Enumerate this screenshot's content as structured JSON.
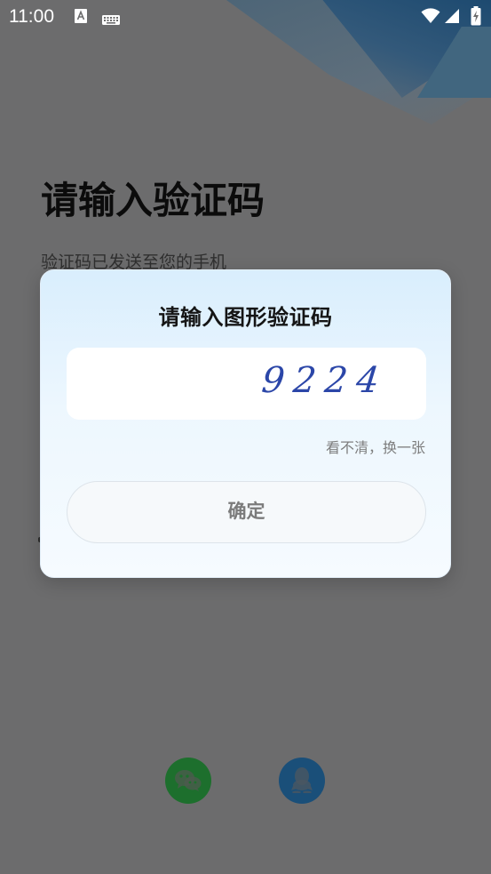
{
  "status_bar": {
    "time": "11:00",
    "icons": [
      "text-a-icon",
      "keyboard-icon",
      "wifi-icon",
      "signal-icon",
      "battery-charging-icon"
    ]
  },
  "page": {
    "title": "请输入验证码",
    "subtitle": "验证码已发送至您的手机"
  },
  "dialog": {
    "title": "请输入图形验证码",
    "captcha_text": "9224",
    "refresh_label": "看不清，换一张",
    "confirm_label": "确定"
  },
  "social_login": {
    "icons": [
      "wechat-icon",
      "qq-icon"
    ]
  },
  "colors": {
    "overlay": "#6c6c6d",
    "wechat": "#1d6f2d",
    "qq": "#1a4f79",
    "captcha": "#2b46a8"
  }
}
